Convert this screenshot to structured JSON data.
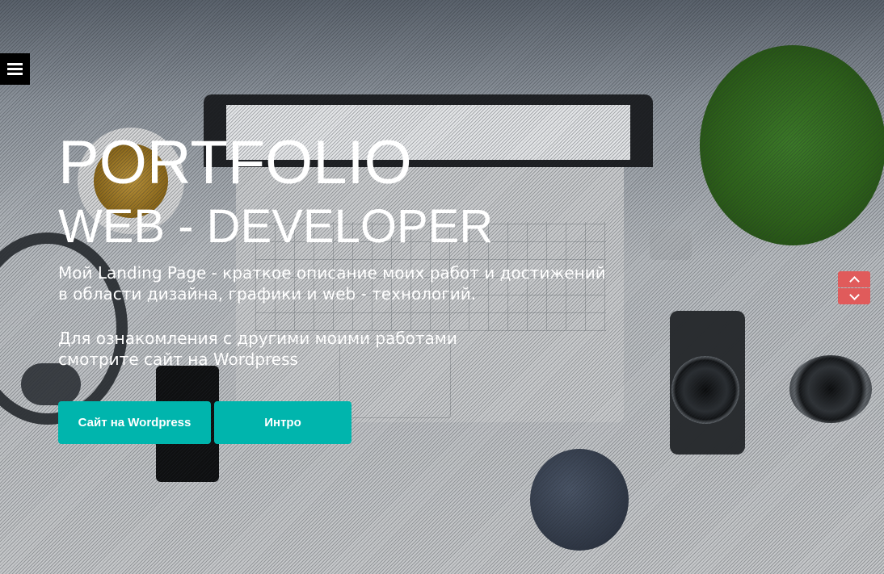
{
  "hero": {
    "title": "PORTFOLIO",
    "subtitle": "WEB - DEVELOPER",
    "description_lines": [
      "Мой Landing Page - краткое описание моих работ и достижений",
      "в области дизайна, графики и web - технологий."
    ],
    "note_lines": [
      "Для ознакомления с другими моими работами",
      "смотрите сайт на Wordpress"
    ]
  },
  "buttons": {
    "wordpress_label": "Сайт на Wordpress",
    "intro_label": "Интро"
  },
  "icons": {
    "menu": "hamburger-menu-icon",
    "scroll_up": "chevron-up-icon",
    "scroll_down": "chevron-down-icon"
  },
  "colors": {
    "accent": "#00b5ad",
    "arrows": "#e05b5b",
    "menu_bg": "#000000"
  }
}
